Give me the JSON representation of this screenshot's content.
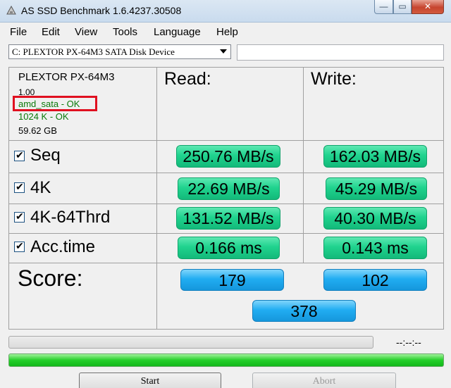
{
  "window": {
    "title": "AS SSD Benchmark 1.6.4237.30508",
    "close_symbol": "✕",
    "min_symbol": "—",
    "max_symbol": "▭"
  },
  "menu": [
    "File",
    "Edit",
    "View",
    "Tools",
    "Language",
    "Help"
  ],
  "device": {
    "selected": "C: PLEXTOR PX-64M3 SATA Disk Device",
    "extra_field": ""
  },
  "info": {
    "model": "PLEXTOR PX-64M3",
    "firmware": "1.00",
    "driver_status": "amd_sata - OK",
    "alignment_status": "1024 K - OK",
    "capacity": "59.62 GB"
  },
  "columns": {
    "read": "Read:",
    "write": "Write:"
  },
  "rows": [
    {
      "label": "Seq",
      "checked": true,
      "read": "250.76 MB/s",
      "write": "162.03 MB/s"
    },
    {
      "label": "4K",
      "checked": true,
      "read": "22.69 MB/s",
      "write": "45.29 MB/s"
    },
    {
      "label": "4K-64Thrd",
      "checked": true,
      "read": "131.52 MB/s",
      "write": "40.30 MB/s"
    },
    {
      "label": "Acc.time",
      "checked": true,
      "read": "0.166 ms",
      "write": "0.143 ms"
    }
  ],
  "score": {
    "label": "Score:",
    "read": "179",
    "write": "102",
    "total": "378"
  },
  "progress": {
    "time": "--:--:--",
    "upper_fraction": 0,
    "lower_fraction": 1
  },
  "buttons": {
    "start": "Start",
    "abort": "Abort"
  },
  "colors": {
    "value_green": "#20d38e",
    "score_blue": "#21adf2",
    "ok_green": "#0a7a0a",
    "highlight_red": "#e01020",
    "progress_green": "#25cf2a"
  }
}
